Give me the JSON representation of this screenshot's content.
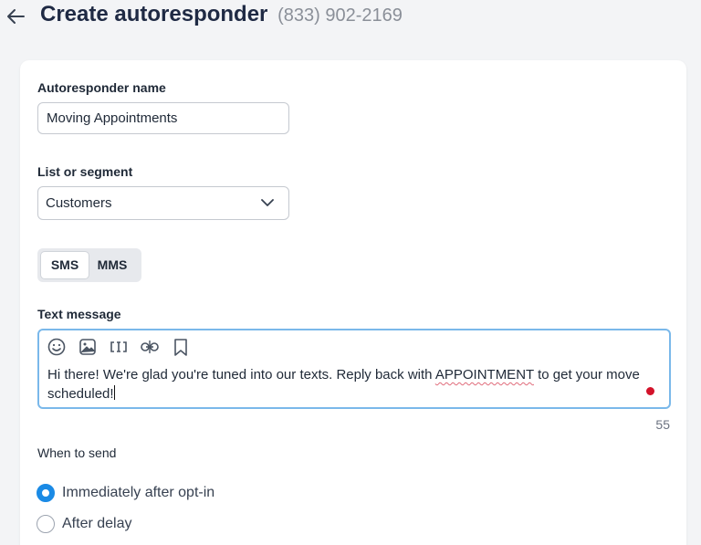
{
  "header": {
    "title": "Create autoresponder",
    "phone": "(833) 902-2169"
  },
  "form": {
    "name_label": "Autoresponder name",
    "name_value": "Moving Appointments",
    "list_label": "List or segment",
    "list_value": "Customers",
    "channel_tabs": [
      {
        "label": "SMS",
        "selected": true
      },
      {
        "label": "MMS",
        "selected": false
      }
    ],
    "message_label": "Text message",
    "toolbar_icons": [
      "emoji-icon",
      "image-icon",
      "merge-field-icon",
      "link-icon",
      "bookmark-icon"
    ],
    "message_part1": "Hi there! We're glad you're tuned into our texts. Reply back with ",
    "message_keyword": "APPOINTMENT",
    "message_part2": " to get your move scheduled!",
    "char_count": "55",
    "when_label": "When to send",
    "when_options": [
      {
        "label": "Immediately after opt-in",
        "selected": true
      },
      {
        "label": "After delay",
        "selected": false
      }
    ]
  },
  "colors": {
    "accent": "#1a8ae5",
    "focus_border": "#7ab8ea",
    "alert_dot": "#d3122a"
  }
}
